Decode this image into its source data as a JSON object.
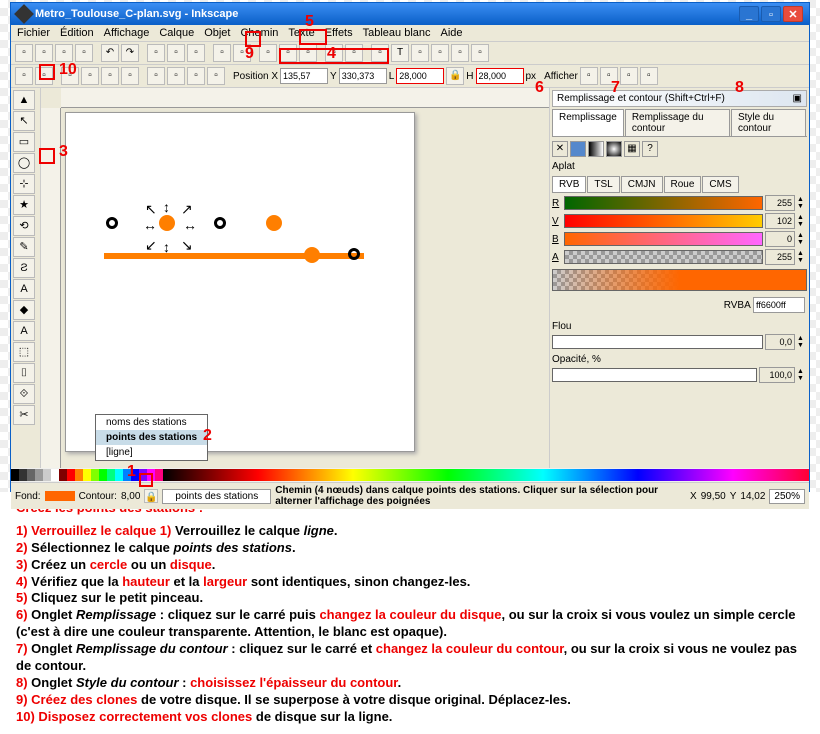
{
  "title": "Metro_Toulouse_C-plan.svg - Inkscape",
  "menu": [
    "Fichier",
    "Édition",
    "Affichage",
    "Calque",
    "Objet",
    "Chemin",
    "Texte",
    "Effets",
    "Tableau blanc",
    "Aide"
  ],
  "toolbar2": {
    "position_x_label": "Position X",
    "x": "135,57",
    "y_label": "Y",
    "y": "330,373",
    "l_label": "L",
    "l": "28,000",
    "h_label": "H",
    "h": "28,000",
    "units": "px",
    "afficher": "Afficher"
  },
  "tools": [
    "▲",
    "↖",
    "▭",
    "◯",
    "★",
    "⟲",
    "✎",
    "Ƨ",
    "A",
    "◆",
    "⬚",
    "⌷",
    "⊹",
    "⟐",
    "✂",
    "☷"
  ],
  "panel": {
    "title": "Remplissage et contour (Shift+Ctrl+F)",
    "tab_fill": "Remplissage",
    "tab_stroke": "Remplissage du contour",
    "tab_style": "Style du contour",
    "aplat": "Aplat",
    "color_modes": [
      "RVB",
      "TSL",
      "CMJN",
      "Roue",
      "CMS"
    ],
    "r_label": "R",
    "r_val": "255",
    "v_label": "V",
    "v_val": "102",
    "b_label": "B",
    "b_val": "0",
    "a_label": "A",
    "a_val": "255",
    "rgba_label": "RVBA",
    "rgba_val": "ff6600ff",
    "flou_label": "Flou",
    "flou_val": "0,0",
    "opacity_label": "Opacité, %",
    "opacity_val": "100,0"
  },
  "layers": {
    "popup": [
      "noms des stations",
      "points des stations",
      "[ligne]"
    ],
    "current": "points des stations"
  },
  "status": {
    "fond_label": "Fond:",
    "fond": "",
    "contour_label": "Contour:",
    "contour_val": "8,00",
    "layer_label": "points des stations",
    "msg": "Chemin (4 nœuds) dans calque points des stations. Cliquer sur la sélection pour alterner l'affichage des poignées",
    "coords_x": "X",
    "coords_y": "Y",
    "cx": "99,50",
    "cy": "14,02",
    "zoom": "250%"
  },
  "annotations": {
    "n1": "1",
    "n2": "2",
    "n3": "3",
    "n4": "4",
    "n5": "5",
    "n6": "6",
    "n7": "7",
    "n8": "8",
    "n9": "9",
    "n10": "10"
  },
  "instructions": {
    "title": "Créez les points des stations :",
    "l1a": "1) Verrouillez le calque ",
    "l1b": "ligne",
    "l1c": ".",
    "l2a": "2) Sélectionnez le calque ",
    "l2b": "points des stations",
    "l2c": ".",
    "l3a": "3) Créez un ",
    "l3b": "cercle",
    "l3c": " ou un ",
    "l3d": "disque",
    "l3e": ".",
    "l4a": "4) Vérifiez que la ",
    "l4b": "hauteur",
    "l4c": " et la ",
    "l4d": "largeur",
    "l4e": " sont identiques, sinon changez-les.",
    "l5": "5) Cliquez sur le petit pinceau.",
    "l6a": "6) Onglet ",
    "l6b": "Remplissage",
    "l6c": " : cliquez sur le carré puis ",
    "l6d": "changez la couleur du disque",
    "l6e": ", ou sur la croix si vous voulez un simple cercle (c'est à dire une couleur transparente. Attention, le blanc est opaque).",
    "l7a": "7) Onglet ",
    "l7b": "Remplissage du contour",
    "l7c": " : cliquez sur le carré et ",
    "l7d": "changez la couleur du contour",
    "l7e": ", ou sur la croix si vous ne voulez pas de contour.",
    "l8a": "8) Onglet ",
    "l8b": "Style du contour",
    "l8c": " : ",
    "l8d": "choisissez l'épaisseur du contour",
    "l8e": ".",
    "l9a": "9) ",
    "l9b": "Créez des clones",
    "l9c": " de votre disque. Il se superpose à votre disque original. Déplacez-les.",
    "l10a": "10) ",
    "l10b": "Disposez correctement vos clones",
    "l10c": " de disque sur la ligne."
  }
}
